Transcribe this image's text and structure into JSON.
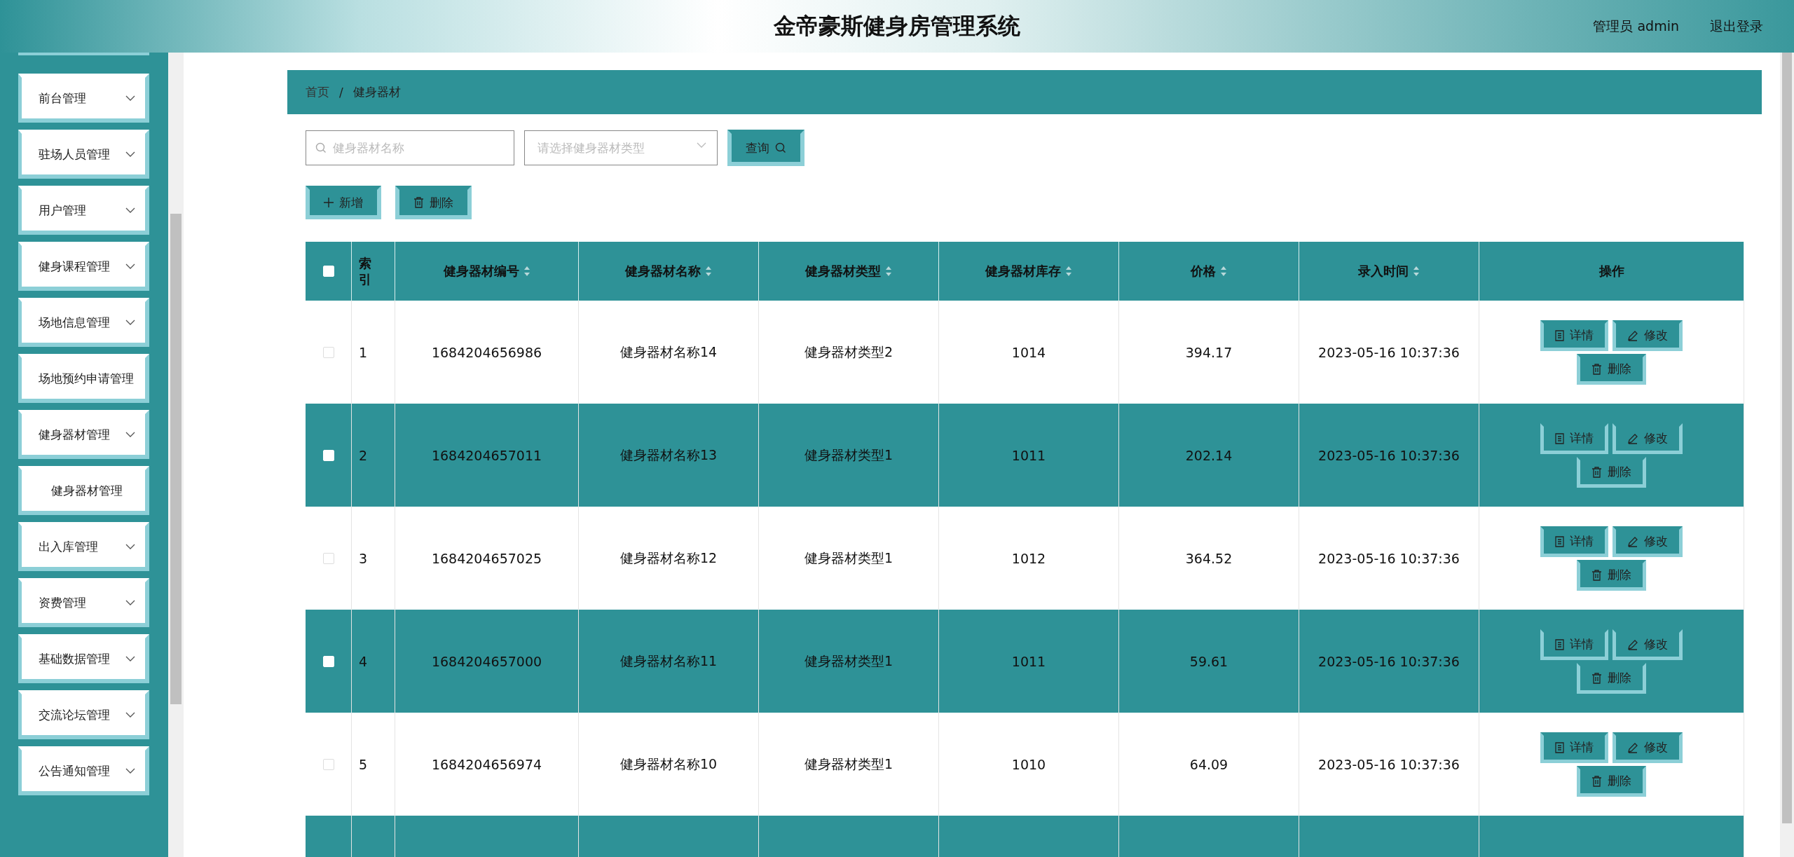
{
  "header": {
    "title": "金帝豪斯健身房管理系统",
    "user": "管理员 admin",
    "logout": "退出登录"
  },
  "sidebar": {
    "items": [
      {
        "label": "前台管理",
        "kind": "group"
      },
      {
        "label": "驻场人员管理",
        "kind": "group"
      },
      {
        "label": "用户管理",
        "kind": "group"
      },
      {
        "label": "健身课程管理",
        "kind": "group"
      },
      {
        "label": "场地信息管理",
        "kind": "group"
      },
      {
        "label": "场地预约申请管理",
        "kind": "link"
      },
      {
        "label": "健身器材管理",
        "kind": "group",
        "children": [
          {
            "label": "健身器材管理"
          }
        ]
      },
      {
        "label": "出入库管理",
        "kind": "group"
      },
      {
        "label": "资费管理",
        "kind": "group"
      },
      {
        "label": "基础数据管理",
        "kind": "group"
      },
      {
        "label": "交流论坛管理",
        "kind": "group"
      },
      {
        "label": "公告通知管理",
        "kind": "group"
      }
    ]
  },
  "breadcrumb": [
    "首页",
    "/",
    "健身器材"
  ],
  "search": {
    "name_placeholder": "健身器材名称",
    "type_placeholder": "请选择健身器材类型",
    "query_button": "查询"
  },
  "actions": [
    "新增",
    "删除"
  ],
  "table": {
    "select_all_checked": false,
    "columns": [
      {
        "label": "索引",
        "sortable": false
      },
      {
        "label": "健身器材编号",
        "sortable": true
      },
      {
        "label": "健身器材名称",
        "sortable": true
      },
      {
        "label": "健身器材类型",
        "sortable": true
      },
      {
        "label": "健身器材库存",
        "sortable": true
      },
      {
        "label": "价格",
        "sortable": true
      },
      {
        "label": "录入时间",
        "sortable": true
      },
      {
        "label": "操作",
        "sortable": false
      }
    ],
    "rows": [
      {
        "checked": false,
        "cells": [
          "1",
          "1684204656986",
          "健身器材名称14",
          "健身器材类型2",
          "1014",
          "394.17",
          "2023-05-16 10:37:36"
        ],
        "actions": [
          "详情",
          "修改",
          "删除"
        ]
      },
      {
        "checked": false,
        "cells": [
          "2",
          "1684204657011",
          "健身器材名称13",
          "健身器材类型1",
          "1011",
          "202.14",
          "2023-05-16 10:37:36"
        ],
        "actions": [
          "详情",
          "修改",
          "删除"
        ]
      },
      {
        "checked": false,
        "cells": [
          "3",
          "1684204657025",
          "健身器材名称12",
          "健身器材类型1",
          "1012",
          "364.52",
          "2023-05-16 10:37:36"
        ],
        "actions": [
          "详情",
          "修改",
          "删除"
        ]
      },
      {
        "checked": false,
        "cells": [
          "4",
          "1684204657000",
          "健身器材名称11",
          "健身器材类型1",
          "1011",
          "59.61",
          "2023-05-16 10:37:36"
        ],
        "actions": [
          "详情",
          "修改",
          "删除"
        ]
      },
      {
        "checked": false,
        "cells": [
          "5",
          "1684204656974",
          "健身器材名称10",
          "健身器材类型1",
          "1010",
          "64.09",
          "2023-05-16 10:37:36"
        ],
        "actions": [
          "详情",
          "修改",
          "删除"
        ]
      }
    ]
  }
}
